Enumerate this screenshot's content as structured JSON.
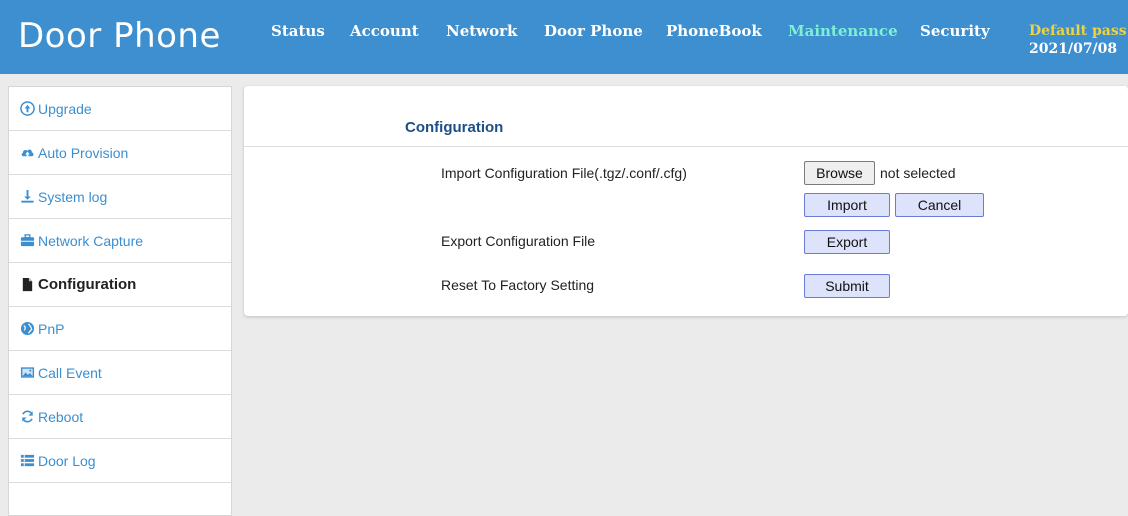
{
  "header": {
    "brand": "Door Phone",
    "nav": [
      "Status",
      "Account",
      "Network",
      "Door Phone",
      "PhoneBook",
      "Maintenance",
      "Security"
    ],
    "active_nav": "Maintenance",
    "notice_line1": "Default pass",
    "notice_line2": "2021/07/08"
  },
  "sidebar": {
    "items": [
      {
        "label": "Upgrade",
        "icon": "arrow-up-circle-icon"
      },
      {
        "label": "Auto Provision",
        "icon": "cloud-upload-icon"
      },
      {
        "label": "System log",
        "icon": "download-icon"
      },
      {
        "label": "Network Capture",
        "icon": "briefcase-icon"
      },
      {
        "label": "Configuration",
        "icon": "file-icon"
      },
      {
        "label": "PnP",
        "icon": "globe-icon"
      },
      {
        "label": "Call Event",
        "icon": "picture-icon"
      },
      {
        "label": "Reboot",
        "icon": "refresh-icon"
      },
      {
        "label": "Door Log",
        "icon": "list-icon"
      }
    ],
    "active": "Configuration"
  },
  "main": {
    "title": "Configuration",
    "import_label": "Import Configuration File(.tgz/.conf/.cfg)",
    "browse_label": "Browse",
    "file_status": "not selected",
    "import_button": "Import",
    "cancel_button": "Cancel",
    "export_label": "Export Configuration File",
    "export_button": "Export",
    "reset_label": "Reset To Factory Setting",
    "submit_button": "Submit"
  },
  "colors": {
    "header_bg": "#3d8fd0",
    "active_nav": "#7ef0d2",
    "notice": "#f0d23c",
    "sidebar_link": "#3b8fd0",
    "panel_title": "#1d4f86",
    "button_blue_bg": "#dde3fa"
  }
}
